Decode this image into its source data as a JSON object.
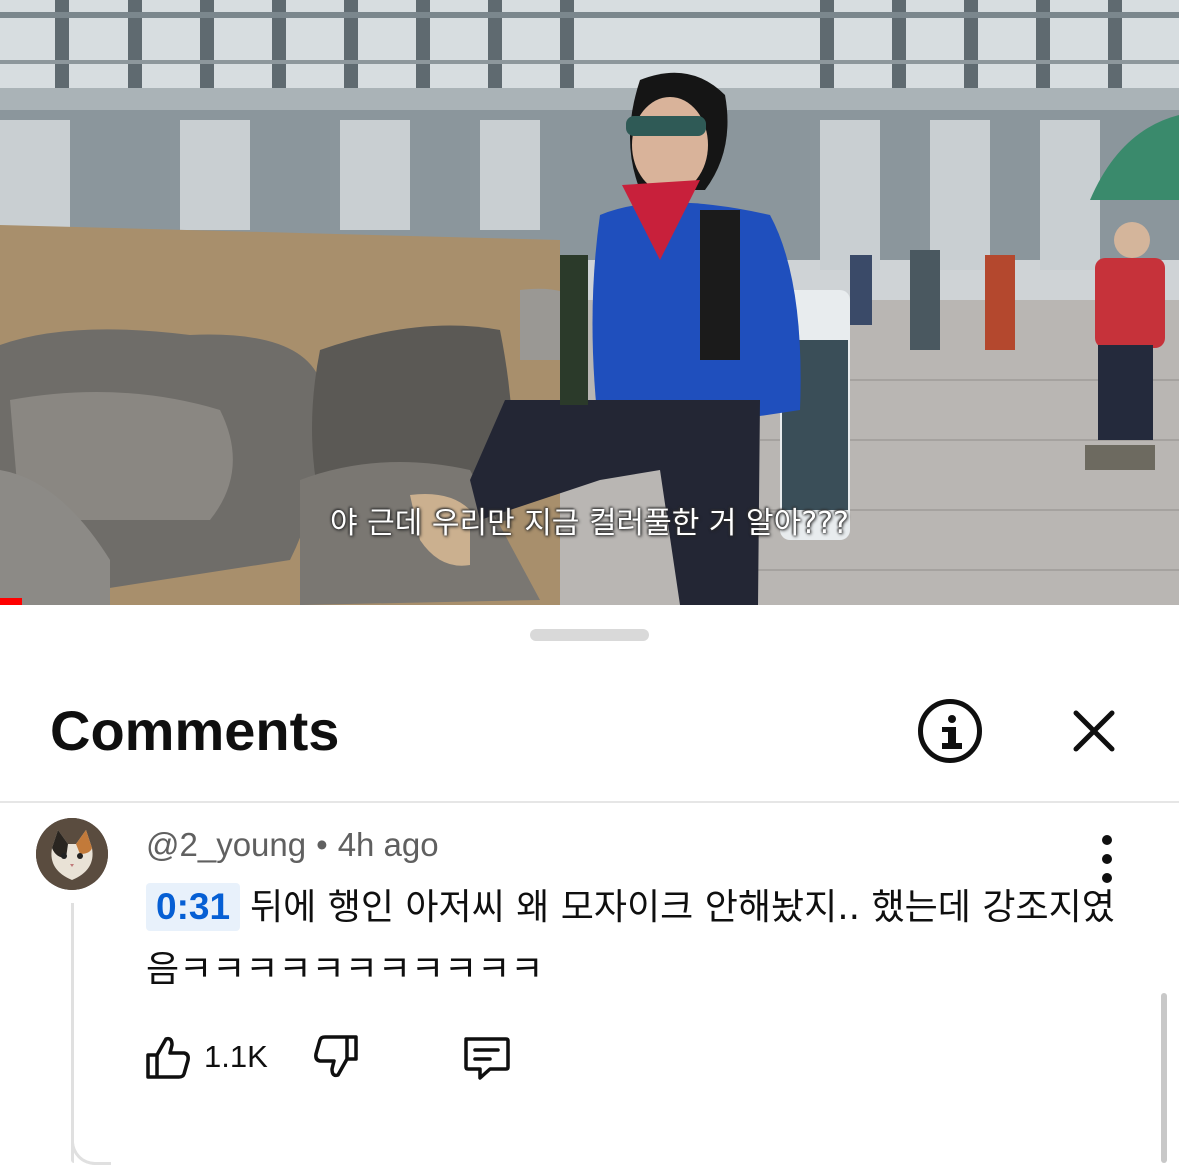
{
  "video": {
    "subtitle": "야 근데 우리만 지금 컬러풀한 거 알아???",
    "progress_fraction": 0.019
  },
  "sheet": {
    "title": "Comments",
    "info_icon": "info-icon",
    "close_icon": "close-icon"
  },
  "comment": {
    "author": "@2_young",
    "separator": "•",
    "time_ago": "4h ago",
    "timestamp": "0:31",
    "text": "뒤에 행인 아저씨 왜 모자이크 안해놨지.. 했는데 강조지였음ㅋㅋㅋㅋㅋㅋㅋㅋㅋㅋㅋ",
    "like_count": "1.1K",
    "icons": {
      "like": "thumbs-up-icon",
      "dislike": "thumbs-down-icon",
      "reply": "reply-icon",
      "more": "more-vert-icon"
    }
  },
  "colors": {
    "accent_link": "#065fd4",
    "timestamp_bg": "#e8f1fb",
    "progress": "#ff0000",
    "text_primary": "#0f0f0f",
    "text_secondary": "#606060"
  }
}
